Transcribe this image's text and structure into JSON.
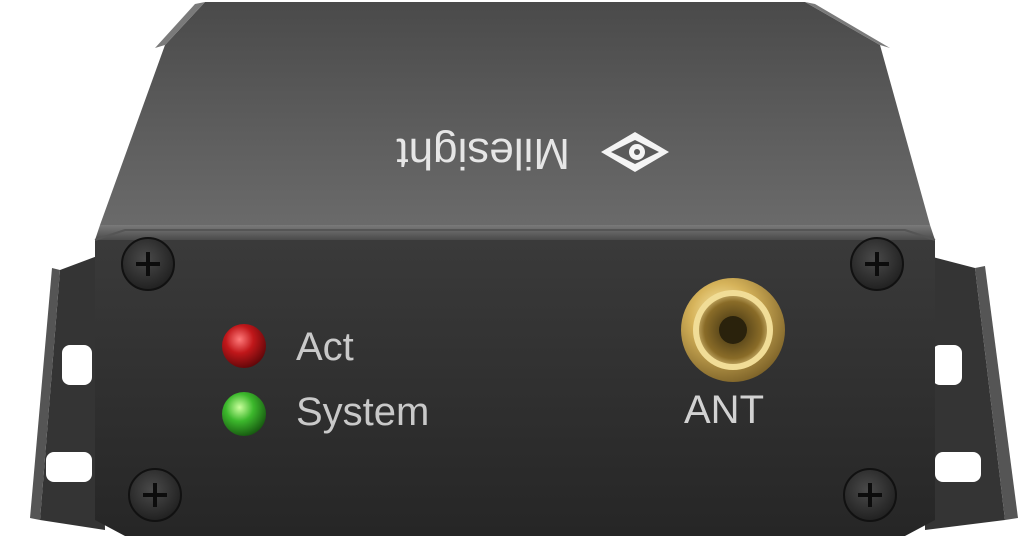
{
  "device": {
    "brand": "Milesight",
    "leds": [
      {
        "label": "Act",
        "color": "#c0171a"
      },
      {
        "label": "System",
        "color": "#3cb82c"
      }
    ],
    "connector_label": "ANT"
  },
  "colors": {
    "housing_top": "#5a5a5a",
    "housing_front": "#2d2d2d",
    "bracket": "#3a3a3a",
    "connector": "#c9a54a"
  },
  "icons": [
    "milesight-logo-icon",
    "screw-icon",
    "sma-connector-icon",
    "mounting-hole-icon"
  ]
}
